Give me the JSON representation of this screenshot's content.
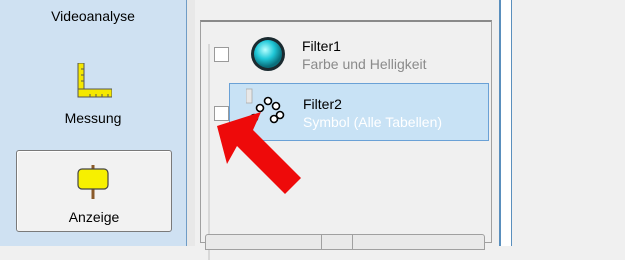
{
  "toolstrip": {
    "items": [
      {
        "label": "Videoanalyse",
        "icon": "video-analysis-icon"
      },
      {
        "label": "Messung",
        "icon": "measure-ruler-icon"
      },
      {
        "label": "Anzeige",
        "icon": "display-sign-icon",
        "selected": true
      }
    ]
  },
  "filters": {
    "rows": [
      {
        "name": "Filter1",
        "description": "Farbe und Helligkeit",
        "icon": "color-brightness-icon",
        "checked": false,
        "selected": false
      },
      {
        "name": "Filter2",
        "description": "Symbol (Alle Tabellen)",
        "icon": "symbol-icon",
        "checked": false,
        "selected": true
      }
    ]
  },
  "annotation": {
    "icon": "red-pointer-arrow",
    "color": "#ee0a0a"
  },
  "colors": {
    "toolstrip_bg": "#cfe1f2",
    "selection_bg": "#c8e2f5",
    "selection_border": "#6aa1d6"
  }
}
